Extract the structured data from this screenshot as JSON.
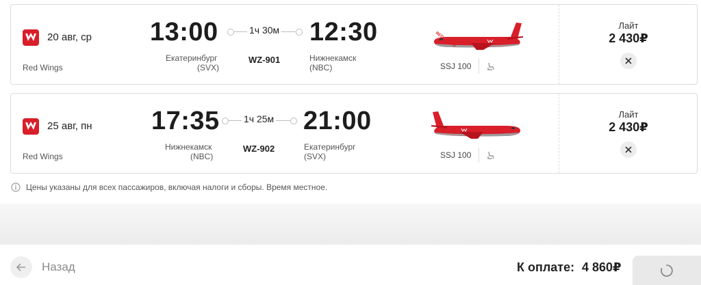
{
  "flights": [
    {
      "date": "20 авг, ср",
      "airline": "Red Wings",
      "dep_time": "13:00",
      "arr_time": "12:30",
      "duration": "1ч 30м",
      "flight_no": "WZ-901",
      "dep_city": "Екатеринбург",
      "dep_code": "(SVX)",
      "arr_city": "Нижнекамск",
      "arr_code": "(NBC)",
      "aircraft": "SSJ 100",
      "fare": "Лайт",
      "price": "2 430₽"
    },
    {
      "date": "25 авг, пн",
      "airline": "Red Wings",
      "dep_time": "17:35",
      "arr_time": "21:00",
      "duration": "1ч 25м",
      "flight_no": "WZ-902",
      "dep_city": "Нижнекамск",
      "dep_code": "(NBC)",
      "arr_city": "Екатеринбург",
      "arr_code": "(SVX)",
      "aircraft": "SSJ 100",
      "fare": "Лайт",
      "price": "2 430₽"
    }
  ],
  "note": "Цены указаны для всех пассажиров, включая налоги и сборы. Время местное.",
  "footer": {
    "back_label": "Назад",
    "total_label": "К оплате:",
    "total_value": "4 860₽"
  },
  "icons": {
    "logo": "red-wings-logo-icon",
    "seat": "seat-icon",
    "remove": "close-icon",
    "info": "info-icon",
    "back": "arrow-left-icon",
    "loading": "spinner-icon"
  },
  "colors": {
    "brand": "#d81f2a",
    "text": "#1d1d1d",
    "muted": "#555555",
    "border": "#dcdcdc"
  }
}
